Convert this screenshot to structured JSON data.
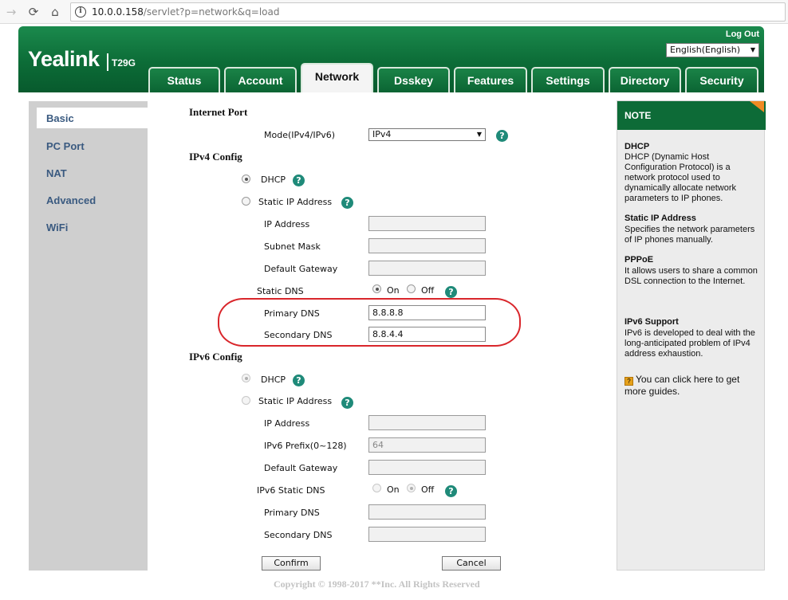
{
  "browser": {
    "back_icon": "back-arrow-icon",
    "reload_icon": "reload-icon",
    "home_icon": "home-icon",
    "url_host": "10.0.0.158",
    "url_path": "/servlet?p=network&q=load"
  },
  "header": {
    "logo": "Yealink",
    "model": "T29G",
    "logout": "Log Out",
    "language": "English(English)",
    "colors": {
      "brand_green": "#0c6c37",
      "note_corner": "#f08a24"
    }
  },
  "tabs": [
    {
      "label": "Status"
    },
    {
      "label": "Account"
    },
    {
      "label": "Network",
      "active": true
    },
    {
      "label": "Dsskey"
    },
    {
      "label": "Features"
    },
    {
      "label": "Settings"
    },
    {
      "label": "Directory"
    },
    {
      "label": "Security"
    }
  ],
  "sidebar": {
    "items": [
      {
        "label": "Basic",
        "active": true
      },
      {
        "label": "PC Port"
      },
      {
        "label": "NAT"
      },
      {
        "label": "Advanced"
      },
      {
        "label": "WiFi"
      }
    ]
  },
  "internet_port": {
    "title": "Internet Port",
    "mode_label": "Mode(IPv4/IPv6)",
    "mode_value": "IPv4"
  },
  "ipv4": {
    "title": "IPv4 Config",
    "dhcp_label": "DHCP",
    "dhcp_selected": true,
    "static_label": "Static IP Address",
    "ip_label": "IP Address",
    "ip_value": "",
    "subnet_label": "Subnet Mask",
    "subnet_value": "",
    "gateway_label": "Default Gateway",
    "gateway_value": "",
    "static_dns_label": "Static DNS",
    "on_label": "On",
    "off_label": "Off",
    "static_dns_on": true,
    "primary_dns_label": "Primary DNS",
    "primary_dns_value": "8.8.8.8",
    "secondary_dns_label": "Secondary DNS",
    "secondary_dns_value": "8.8.4.4"
  },
  "ipv6": {
    "title": "IPv6 Config",
    "dhcp_label": "DHCP",
    "static_label": "Static IP Address",
    "ip_label": "IP Address",
    "ip_value": "",
    "prefix_label": "IPv6 Prefix(0~128)",
    "prefix_value": "64",
    "gateway_label": "Default Gateway",
    "gateway_value": "",
    "static_dns_label": "IPv6 Static DNS",
    "on_label": "On",
    "off_label": "Off",
    "primary_dns_label": "Primary DNS",
    "primary_dns_value": "",
    "secondary_dns_label": "Secondary DNS",
    "secondary_dns_value": ""
  },
  "actions": {
    "confirm": "Confirm",
    "cancel": "Cancel"
  },
  "footer": {
    "copyright": "Copyright © 1998-2017 **Inc. All Rights Reserved"
  },
  "note": {
    "header": "NOTE",
    "dhcp_title": "DHCP",
    "dhcp_text": "DHCP (Dynamic Host Configuration Protocol) is a network protocol used to dynamically allocate network parameters to IP phones.",
    "static_title": "Static IP Address",
    "static_text": "Specifies the network parameters of IP phones manually.",
    "pppoe_title": "PPPoE",
    "pppoe_text": "It allows users to share a common DSL connection to the Internet.",
    "ipv6_title": "IPv6 Support",
    "ipv6_text": "IPv6 is developed to deal with the long-anticipated problem of IPv4 address exhaustion.",
    "guide_text": "You can click here to get more guides."
  },
  "help_glyph": "?"
}
